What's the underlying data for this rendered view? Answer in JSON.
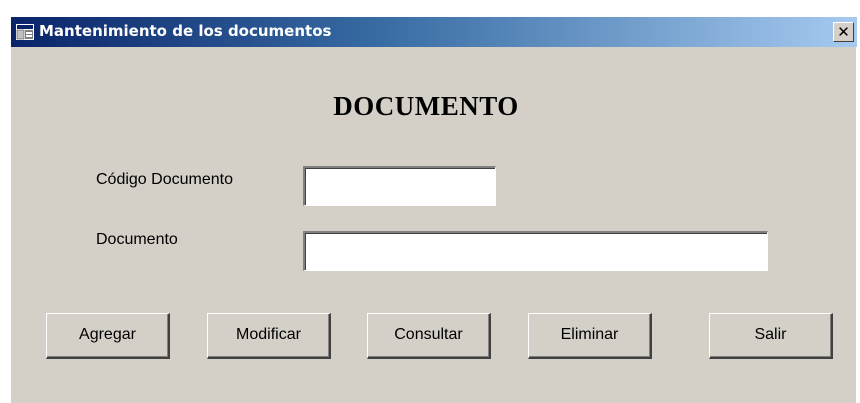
{
  "window": {
    "title": "Mantenimiento de los documentos",
    "close_glyph": "✕",
    "icon": "application-window-icon"
  },
  "form": {
    "heading": "DOCUMENTO",
    "code_label": "Código Documento",
    "code_value": "",
    "document_label": "Documento",
    "document_value": ""
  },
  "buttons": {
    "add": "Agregar",
    "modify": "Modificar",
    "query": "Consultar",
    "delete": "Eliminar",
    "exit": "Salir"
  },
  "colors": {
    "titlebar_start": "#0a246a",
    "titlebar_end": "#a6caf0",
    "window_face": "#d4d0c8"
  }
}
